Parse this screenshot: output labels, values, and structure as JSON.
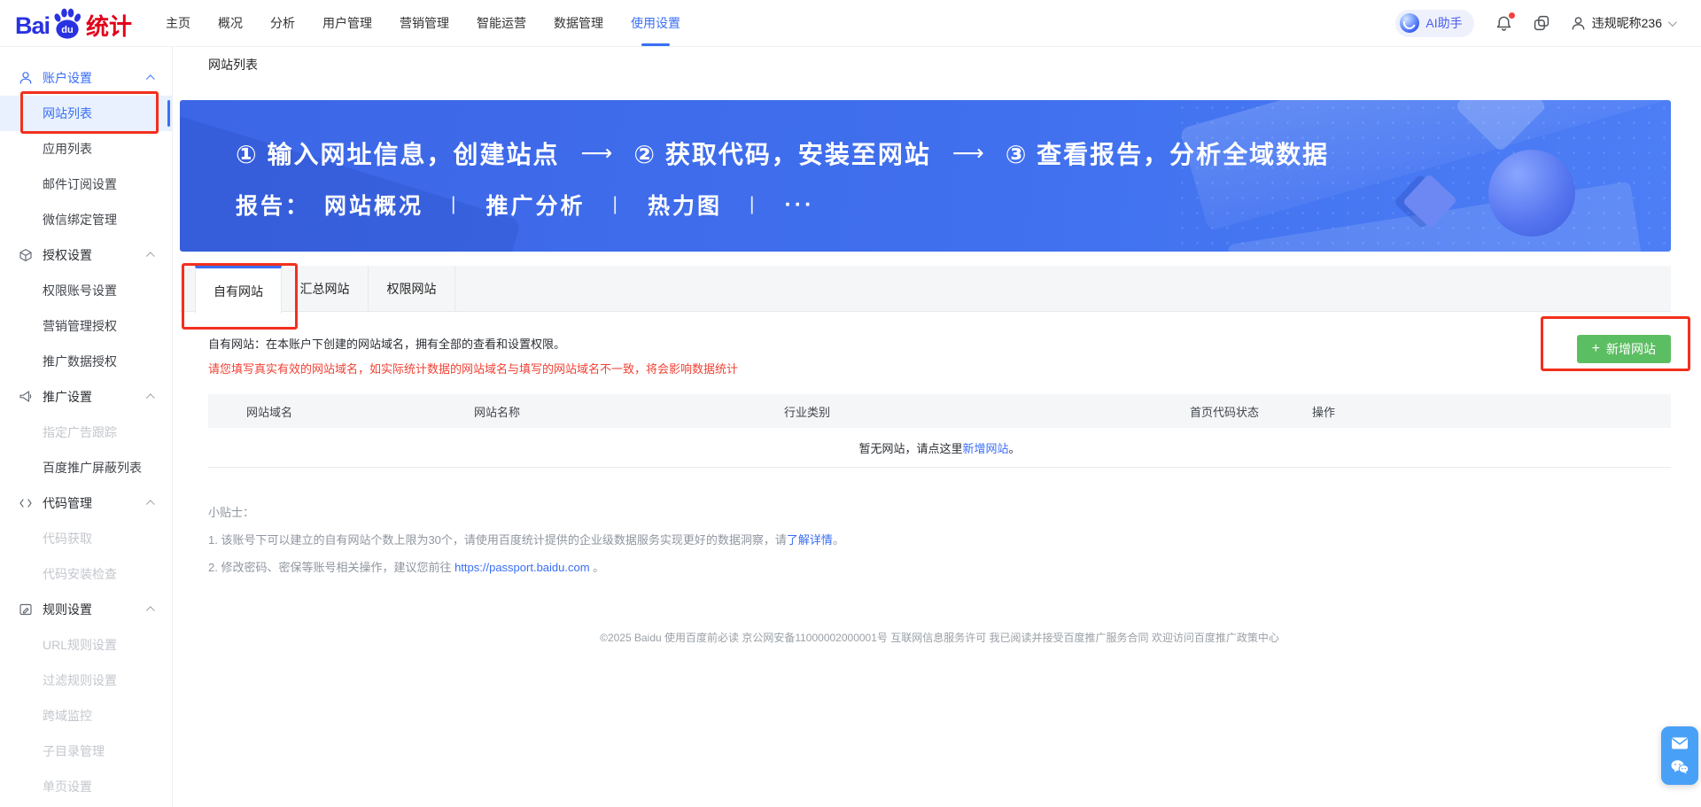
{
  "brand": {
    "bai": "Bai",
    "du": "du",
    "tongji": "统计"
  },
  "topnav": {
    "items": [
      "主页",
      "概况",
      "分析",
      "用户管理",
      "营销管理",
      "智能运营",
      "数据管理",
      "使用设置"
    ]
  },
  "userbar": {
    "ai_assistant": "AI助手",
    "username": "违规昵称236"
  },
  "sidebar": {
    "sections": [
      {
        "label": "账户设置",
        "items": [
          {
            "label": "网站列表"
          },
          {
            "label": "应用列表"
          },
          {
            "label": "邮件订阅设置"
          },
          {
            "label": "微信绑定管理"
          }
        ]
      },
      {
        "label": "授权设置",
        "items": [
          {
            "label": "权限账号设置"
          },
          {
            "label": "营销管理授权"
          },
          {
            "label": "推广数据授权"
          }
        ]
      },
      {
        "label": "推广设置",
        "items": [
          {
            "label": "指定广告跟踪"
          },
          {
            "label": "百度推广屏蔽列表"
          }
        ]
      },
      {
        "label": "代码管理",
        "items": [
          {
            "label": "代码获取"
          },
          {
            "label": "代码安装检查"
          }
        ]
      },
      {
        "label": "规则设置",
        "items": [
          {
            "label": "URL规则设置"
          },
          {
            "label": "过滤规则设置"
          },
          {
            "label": "跨域监控"
          },
          {
            "label": "子目录管理"
          },
          {
            "label": "单页设置"
          }
        ]
      }
    ]
  },
  "breadcrumb": "网站列表",
  "banner": {
    "step1": "① 输入网址信息，创建站点",
    "step2": "② 获取代码，安装至网站",
    "step3": "③ 查看报告，分析全域数据",
    "arrow": "⟶",
    "reports_label": "报告：",
    "reports": [
      "网站概况",
      "推广分析",
      "热力图",
      "···"
    ],
    "divider": "|"
  },
  "tabs": [
    "自有网站",
    "汇总网站",
    "权限网站"
  ],
  "panel": {
    "desc": "自有网站：在本账户下创建的网站域名，拥有全部的查看和设置权限。",
    "warning": "请您填写真实有效的网站域名，如实际统计数据的网站域名与填写的网站域名不一致，将会影响数据统计",
    "add_icon": "+",
    "add_label": "新增网站",
    "table_headers": [
      "网站域名",
      "网站名称",
      "行业类别",
      "首页代码状态",
      "操作"
    ],
    "empty_prefix": "暂无网站，请点这里 ",
    "empty_link": "新增网站",
    "empty_suffix": "。",
    "tips_title": "小贴士：",
    "tip1_prefix": "1. 该账号下可以建立的自有网站个数上限为30个，请使用百度统计提供的企业级数据服务实现更好的数据洞察，请",
    "tip1_link": "了解详情",
    "tip1_suffix": "。",
    "tip2_prefix": "2. 修改密码、密保等账号相关操作，建议您前往 ",
    "tip2_link": "https://passport.baidu.com",
    "tip2_suffix": " 。"
  },
  "footer": "©2025 Baidu 使用百度前必读 京公网安备11000002000001号 互联网信息服务许可 我已阅读并接受百度推广服务合同 欢迎访问百度推广政策中心",
  "colors": {
    "primary": "#3a6ef5",
    "green": "#5cbe62",
    "annotation_red": "#f2301d",
    "warning_red": "#f04134",
    "banner_start": "#3c66e6",
    "banner_end": "#4d7ef6",
    "widget_blue": "#49a0f7",
    "logo_blue": "#2932e1",
    "logo_red": "#e2001a"
  }
}
